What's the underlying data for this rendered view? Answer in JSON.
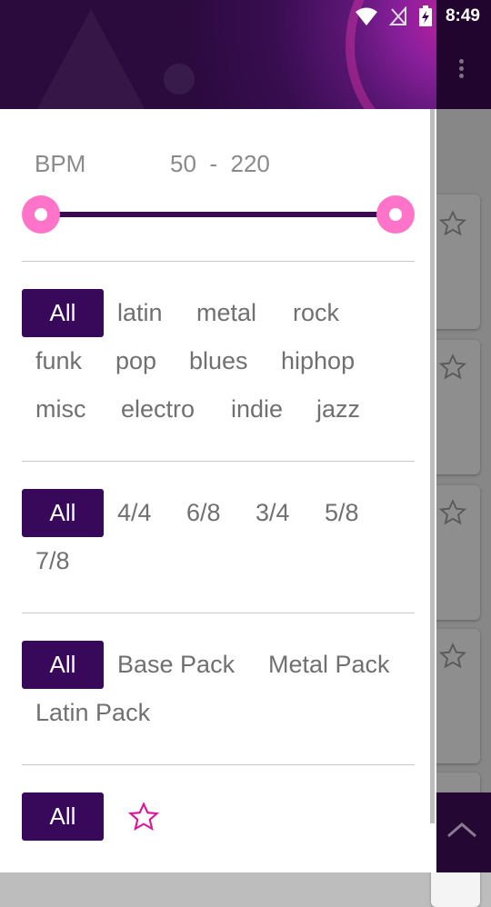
{
  "status_bar": {
    "time": "8:49"
  },
  "bpm": {
    "label": "BPM",
    "min": "50",
    "separator": "-",
    "max": "220"
  },
  "genres": {
    "all_label": "All",
    "items": [
      "latin",
      "metal",
      "rock",
      "funk",
      "pop",
      "blues",
      "hiphop",
      "misc",
      "electro",
      "indie",
      "jazz"
    ]
  },
  "time_signatures": {
    "all_label": "All",
    "items": [
      "4/4",
      "6/8",
      "3/4",
      "5/8",
      "7/8"
    ]
  },
  "packs": {
    "all_label": "All",
    "items": [
      "Base Pack",
      "Metal Pack",
      "Latin Pack"
    ]
  },
  "favorites": {
    "all_label": "All",
    "icon": "star-outline-icon"
  },
  "colors": {
    "accent": "#38085a",
    "thumb": "#ff74c8",
    "star": "#e0129a"
  }
}
